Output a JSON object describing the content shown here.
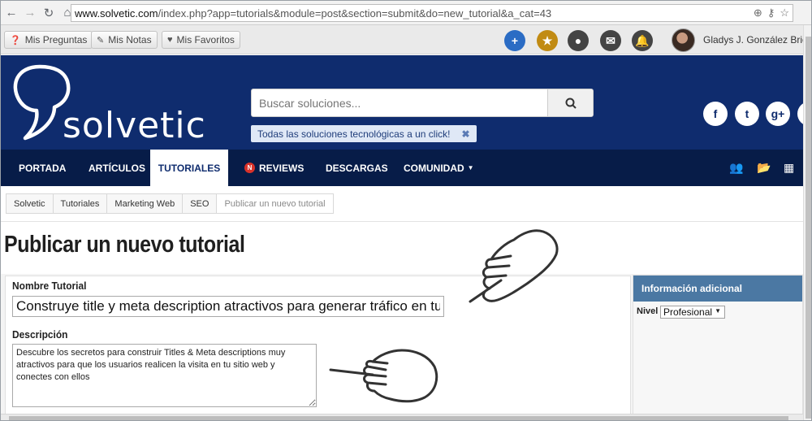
{
  "browser": {
    "url_domain": "www.solvetic.com",
    "url_path": "/index.php?app=tutorials&module=post&section=submit&do=new_tutorial&a_cat=43"
  },
  "userbar": {
    "preguntas": "Mis Preguntas",
    "notas": "Mis Notas",
    "favoritos": "Mis Favoritos",
    "username": "Gladys J. González Brice"
  },
  "header": {
    "logo": "solvetic",
    "search_placeholder": "Buscar soluciones...",
    "tagline": "Todas las soluciones tecnológicas a un click!",
    "social": [
      "f",
      "t",
      "g+"
    ]
  },
  "nav": {
    "items": [
      {
        "label": "PORTADA"
      },
      {
        "label": "ARTÍCULOS"
      },
      {
        "label": "TUTORIALES"
      },
      {
        "label": "REVIEWS",
        "badge": "N"
      },
      {
        "label": "DESCARGAS"
      },
      {
        "label": "COMUNIDAD"
      }
    ],
    "active": "TUTORIALES"
  },
  "breadcrumb": [
    "Solvetic",
    "Tutoriales",
    "Marketing Web",
    "SEO",
    "Publicar un nuevo tutorial"
  ],
  "page": {
    "title": "Publicar un nuevo tutorial"
  },
  "form": {
    "name_label": "Nombre Tutorial",
    "name_value": "Construye title y meta description atractivos para generar tráfico en tu v",
    "desc_label": "Descripción",
    "desc_value": "Descubre los secretos para construir Titles & Meta descriptions muy atractivos para que los usuarios realicen la visita en tu sitio web y conectes con ellos"
  },
  "sidebar": {
    "title": "Información adicional",
    "nivel_label": "Nivel",
    "nivel_value": "Profesional"
  },
  "colors": {
    "header_bg": "#0f2c6e",
    "nav_bg": "#071c48",
    "side_head": "#4b78a3"
  }
}
